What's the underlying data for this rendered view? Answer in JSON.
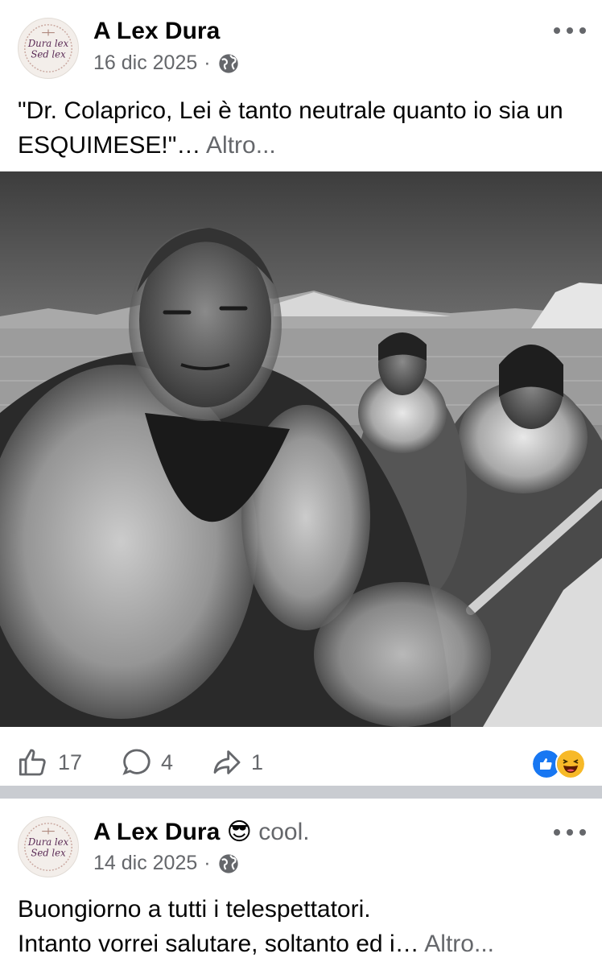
{
  "post1": {
    "author": "A Lex Dura",
    "date": "16 dic 2025",
    "separator": "·",
    "text": "\"Dr. Colaprico, Lei è tanto neutrale quanto io sia un ESQUIMESE!\"…",
    "see_more": "Altro...",
    "likes": "17",
    "comments": "4",
    "shares": "1"
  },
  "post2": {
    "author": "A Lex Dura",
    "feeling_emoji": "😎",
    "feeling": "cool.",
    "date": "14 dic 2025",
    "separator": "·",
    "line1": "Buongiorno a tutti i telespettatori.",
    "line2": "Intanto vorrei salutare, soltanto ed i…",
    "see_more": "Altro..."
  },
  "avatar_text": {
    "line1": "Dura lex",
    "line2": "Sed lex"
  },
  "icons": [
    "globe-icon",
    "more-options-icon",
    "like-icon",
    "comment-icon",
    "share-icon",
    "like-reaction-icon",
    "haha-reaction-icon"
  ],
  "colors": {
    "secondary_text": "#65676b",
    "like_blue": "#1877f2",
    "haha_yellow": "#f7b928",
    "divider": "#c9ccd1"
  }
}
